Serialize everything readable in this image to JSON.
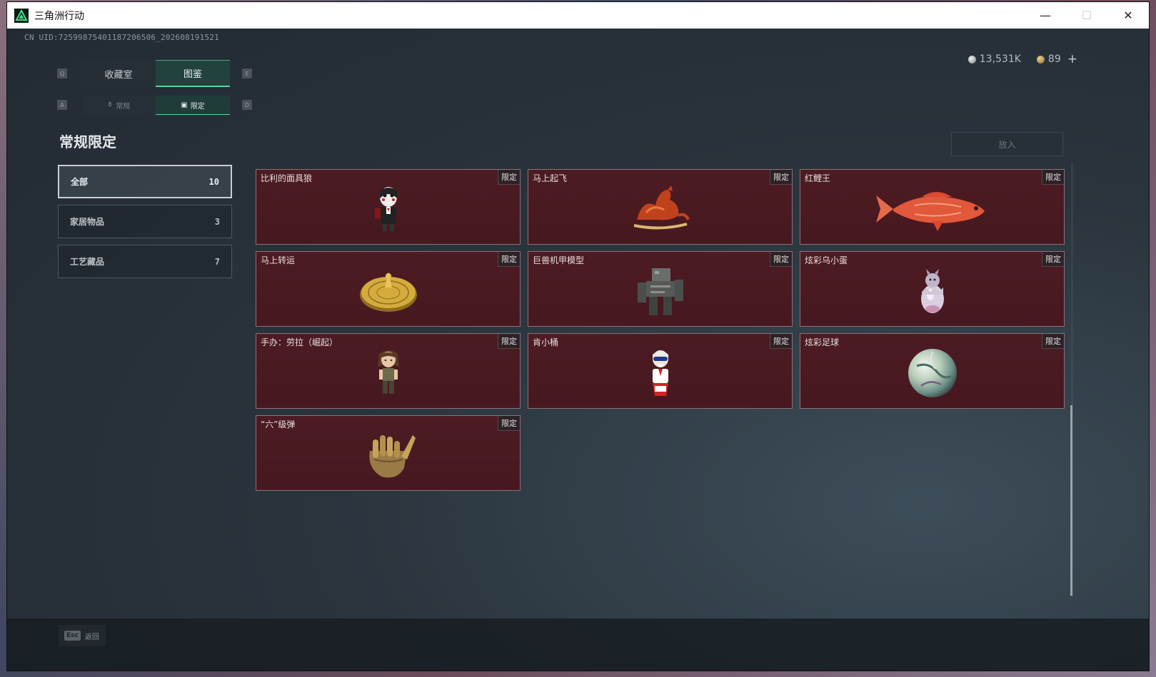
{
  "window": {
    "title": "三角洲行动"
  },
  "titlebar": {
    "minimize": "—",
    "maximize": "☐",
    "close": "✕"
  },
  "uid": "CN UID:7259987540118720650​6_202608191521",
  "currency": {
    "silver": "13,531K",
    "gold": "89",
    "add": "+"
  },
  "keys": {
    "q": "Q",
    "e": "E",
    "a": "A",
    "d": "D"
  },
  "tabs": [
    {
      "label": "收藏室"
    },
    {
      "label": "图鉴"
    }
  ],
  "subtabs": [
    {
      "label": "常规"
    },
    {
      "label": "限定"
    }
  ],
  "section_title": "常规限定",
  "put_button": "放入",
  "categories": [
    {
      "label": "全部",
      "count": "10"
    },
    {
      "label": "家居物品",
      "count": "3"
    },
    {
      "label": "工艺藏品",
      "count": "7"
    }
  ],
  "badge": "限定",
  "items": [
    {
      "name": "比利的面具狼",
      "icon": "doll-figure"
    },
    {
      "name": "马上起飞",
      "icon": "horse-statue"
    },
    {
      "name": "红鲤王",
      "icon": "red-carp"
    },
    {
      "name": "马上转运",
      "icon": "golden-compass"
    },
    {
      "name": "巨兽机甲模型",
      "icon": "mech-model"
    },
    {
      "name": "炫彩乌小蛋",
      "icon": "egg-figure"
    },
    {
      "name": "手办：劳拉（崛起）",
      "icon": "lara-figure"
    },
    {
      "name": "肯小桶",
      "icon": "bucket-figure"
    },
    {
      "name": "炫彩足球",
      "icon": "soccer-ball"
    },
    {
      "name": "“六”级弹",
      "icon": "bullet-hand"
    }
  ],
  "footer": {
    "esc_key": "Esc",
    "back_label": "返回"
  }
}
